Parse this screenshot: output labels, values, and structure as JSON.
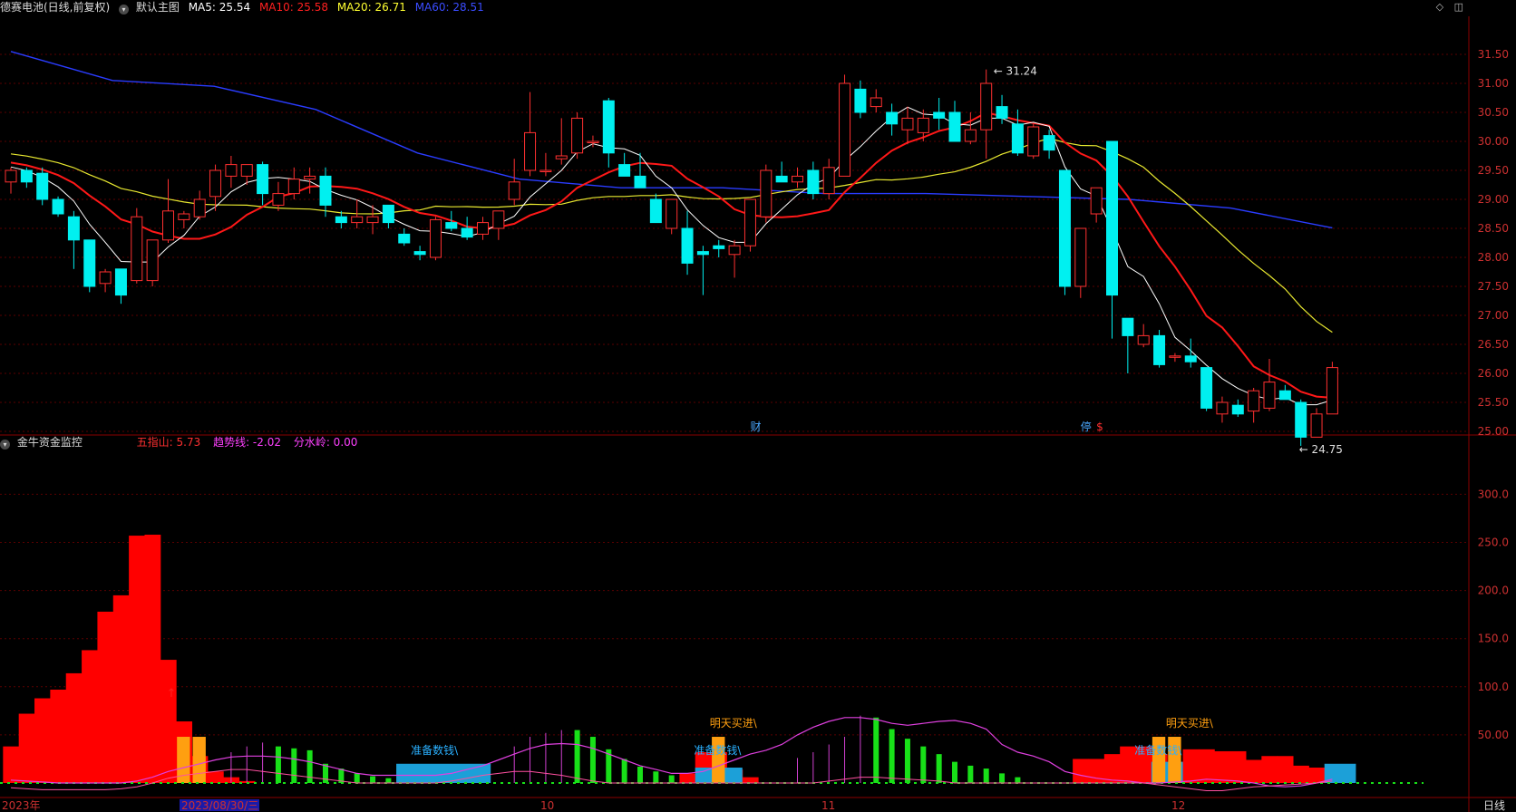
{
  "header": {
    "title": "德赛电池(日线,前复权)",
    "main_chart": "默认主图",
    "ma": [
      {
        "label": "MA5: 25.54",
        "color": "#ffffff"
      },
      {
        "label": "MA10: 25.58",
        "color": "#ff2020"
      },
      {
        "label": "MA20: 26.71",
        "color": "#ffff30"
      },
      {
        "label": "MA60: 28.51",
        "color": "#2a3cff"
      }
    ],
    "window_icons": [
      "◇",
      "◫"
    ]
  },
  "indicator": {
    "title": "金牛资金监控",
    "values": [
      {
        "label": "五指山: 5.73",
        "color": "#ff3030"
      },
      {
        "label": "趋势线: -2.02",
        "color": "#ff40ff"
      },
      {
        "label": "分水岭: 0.00",
        "color": "#ff40ff"
      }
    ]
  },
  "xaxis": {
    "labels": [
      "2023年",
      "2023/08/30/三",
      "10",
      "11",
      "12"
    ],
    "period": "日线"
  },
  "chart_data": [
    {
      "type": "candlestick",
      "ylim": [
        24.6,
        31.75
      ],
      "yticks": [
        "31.50",
        "31.00",
        "30.50",
        "30.00",
        "29.50",
        "29.00",
        "28.50",
        "28.00",
        "27.50",
        "27.00",
        "26.50",
        "26.00",
        "25.50",
        "25.00"
      ],
      "annotations": {
        "high": "31.24",
        "low": "24.75"
      },
      "markers": [
        "财",
        "停",
        "$"
      ],
      "ohlc": [
        [
          29.3,
          29.55,
          29.1,
          29.5
        ],
        [
          29.5,
          29.55,
          29.2,
          29.3
        ],
        [
          29.45,
          29.55,
          28.9,
          29.0
        ],
        [
          29.0,
          29.05,
          28.7,
          28.75
        ],
        [
          28.7,
          28.8,
          27.8,
          28.3
        ],
        [
          28.3,
          28.3,
          27.4,
          27.5
        ],
        [
          27.55,
          27.8,
          27.4,
          27.75
        ],
        [
          27.8,
          27.8,
          27.2,
          27.35
        ],
        [
          27.6,
          28.85,
          27.55,
          28.7
        ],
        [
          27.6,
          28.3,
          27.5,
          28.3
        ],
        [
          28.3,
          29.35,
          28.25,
          28.8
        ],
        [
          28.65,
          28.8,
          28.5,
          28.75
        ],
        [
          28.7,
          29.15,
          28.65,
          29.0
        ],
        [
          29.05,
          29.6,
          28.8,
          29.5
        ],
        [
          29.4,
          29.75,
          29.2,
          29.6
        ],
        [
          29.4,
          29.6,
          29.25,
          29.6
        ],
        [
          29.6,
          29.65,
          28.9,
          29.1
        ],
        [
          28.9,
          29.3,
          28.8,
          29.1
        ],
        [
          29.1,
          29.55,
          29.0,
          29.35
        ],
        [
          29.35,
          29.55,
          29.1,
          29.4
        ],
        [
          29.4,
          29.55,
          28.7,
          28.9
        ],
        [
          28.7,
          28.8,
          28.5,
          28.6
        ],
        [
          28.6,
          29.0,
          28.5,
          28.7
        ],
        [
          28.6,
          28.9,
          28.4,
          28.7
        ],
        [
          28.9,
          28.9,
          28.5,
          28.6
        ],
        [
          28.4,
          28.5,
          28.2,
          28.25
        ],
        [
          28.1,
          28.2,
          27.95,
          28.05
        ],
        [
          28.0,
          28.7,
          27.95,
          28.65
        ],
        [
          28.6,
          28.8,
          28.45,
          28.5
        ],
        [
          28.5,
          28.7,
          28.3,
          28.35
        ],
        [
          28.4,
          28.7,
          28.3,
          28.6
        ],
        [
          28.5,
          28.8,
          28.3,
          28.8
        ],
        [
          29.0,
          29.7,
          28.9,
          29.3
        ],
        [
          29.5,
          30.85,
          29.4,
          30.15
        ],
        [
          29.5,
          29.8,
          29.4,
          29.5
        ],
        [
          29.7,
          30.4,
          29.6,
          29.75
        ],
        [
          29.8,
          30.5,
          29.7,
          30.4
        ],
        [
          30.0,
          30.1,
          29.9,
          30.0
        ],
        [
          30.7,
          30.75,
          29.55,
          29.8
        ],
        [
          29.6,
          29.8,
          29.4,
          29.4
        ],
        [
          29.4,
          29.8,
          29.2,
          29.2
        ],
        [
          29.0,
          29.1,
          28.6,
          28.6
        ],
        [
          28.5,
          28.9,
          28.4,
          29.0
        ],
        [
          28.5,
          28.8,
          27.7,
          27.9
        ],
        [
          28.1,
          28.2,
          27.35,
          28.05
        ],
        [
          28.2,
          28.3,
          28.0,
          28.15
        ],
        [
          28.05,
          28.3,
          27.65,
          28.2
        ],
        [
          28.2,
          29.0,
          28.1,
          29.0
        ],
        [
          28.7,
          29.6,
          28.6,
          29.5
        ],
        [
          29.4,
          29.65,
          29.3,
          29.3
        ],
        [
          29.3,
          29.55,
          29.2,
          29.4
        ],
        [
          29.5,
          29.65,
          29.0,
          29.1
        ],
        [
          29.1,
          29.7,
          29.0,
          29.55
        ],
        [
          29.4,
          31.15,
          29.4,
          31.0
        ],
        [
          30.9,
          31.05,
          30.4,
          30.5
        ],
        [
          30.6,
          30.9,
          30.5,
          30.75
        ],
        [
          30.5,
          30.65,
          30.1,
          30.3
        ],
        [
          30.2,
          30.6,
          29.95,
          30.4
        ],
        [
          30.15,
          30.55,
          30.0,
          30.4
        ],
        [
          30.5,
          30.75,
          30.2,
          30.4
        ],
        [
          30.5,
          30.7,
          30.0,
          30.0
        ],
        [
          30.0,
          30.5,
          29.95,
          30.2
        ],
        [
          30.2,
          31.24,
          29.7,
          31.0
        ],
        [
          30.6,
          30.8,
          30.3,
          30.4
        ],
        [
          30.3,
          30.55,
          29.75,
          29.8
        ],
        [
          29.75,
          30.3,
          29.7,
          30.25
        ],
        [
          30.1,
          30.2,
          29.7,
          29.85
        ],
        [
          29.5,
          29.5,
          27.35,
          27.5
        ],
        [
          27.5,
          28.5,
          27.3,
          28.5
        ],
        [
          28.75,
          29.2,
          28.6,
          29.2
        ],
        [
          30.0,
          30.0,
          26.6,
          27.35
        ],
        [
          26.95,
          26.95,
          26.0,
          26.65
        ],
        [
          26.5,
          26.85,
          26.45,
          26.65
        ],
        [
          26.65,
          26.75,
          26.1,
          26.15
        ],
        [
          26.3,
          26.35,
          26.2,
          26.3
        ],
        [
          26.3,
          26.6,
          26.1,
          26.2
        ],
        [
          26.1,
          26.1,
          25.35,
          25.4
        ],
        [
          25.3,
          25.6,
          25.15,
          25.5
        ],
        [
          25.45,
          25.55,
          25.25,
          25.3
        ],
        [
          25.35,
          25.75,
          25.15,
          25.7
        ],
        [
          25.4,
          26.25,
          25.35,
          25.85
        ],
        [
          25.7,
          25.8,
          25.6,
          25.55
        ],
        [
          25.5,
          25.55,
          24.75,
          24.9
        ],
        [
          24.9,
          25.4,
          24.9,
          25.3
        ],
        [
          25.3,
          26.2,
          25.3,
          26.1
        ]
      ],
      "ma60": [
        31.55,
        31.05,
        30.95,
        30.55,
        29.8,
        29.35,
        29.2,
        29.2,
        29.1,
        29.1,
        29.05,
        29.0,
        28.85,
        28.51
      ]
    },
    {
      "type": "bar",
      "ylim": [
        -5,
        345
      ],
      "yticks": [
        "300.0",
        "250.0",
        "200.0",
        "150.0",
        "100.0",
        "50.00"
      ],
      "labels": [
        "准备数钱\\",
        "准备数钱\\",
        "准备数钱\\",
        "明天买进\\",
        "明天买进\\"
      ],
      "red_bars": [
        38,
        72,
        88,
        97,
        114,
        138,
        178,
        195,
        257,
        258,
        128,
        64,
        28,
        12,
        6,
        2,
        0,
        0,
        0,
        0,
        0,
        0,
        0,
        0,
        0,
        0,
        0,
        0,
        0,
        0,
        0,
        0,
        0,
        0,
        0,
        0,
        0,
        0,
        0,
        0,
        0,
        0,
        0,
        10,
        32,
        32,
        14,
        6,
        0,
        0,
        0,
        0,
        0,
        0,
        0,
        0,
        0,
        0,
        0,
        0,
        0,
        0,
        0,
        0,
        0,
        0,
        0,
        0,
        25,
        25,
        30,
        38,
        38,
        30,
        22,
        35,
        35,
        33,
        33,
        24,
        28,
        28,
        18,
        16,
        8
      ]
    }
  ]
}
